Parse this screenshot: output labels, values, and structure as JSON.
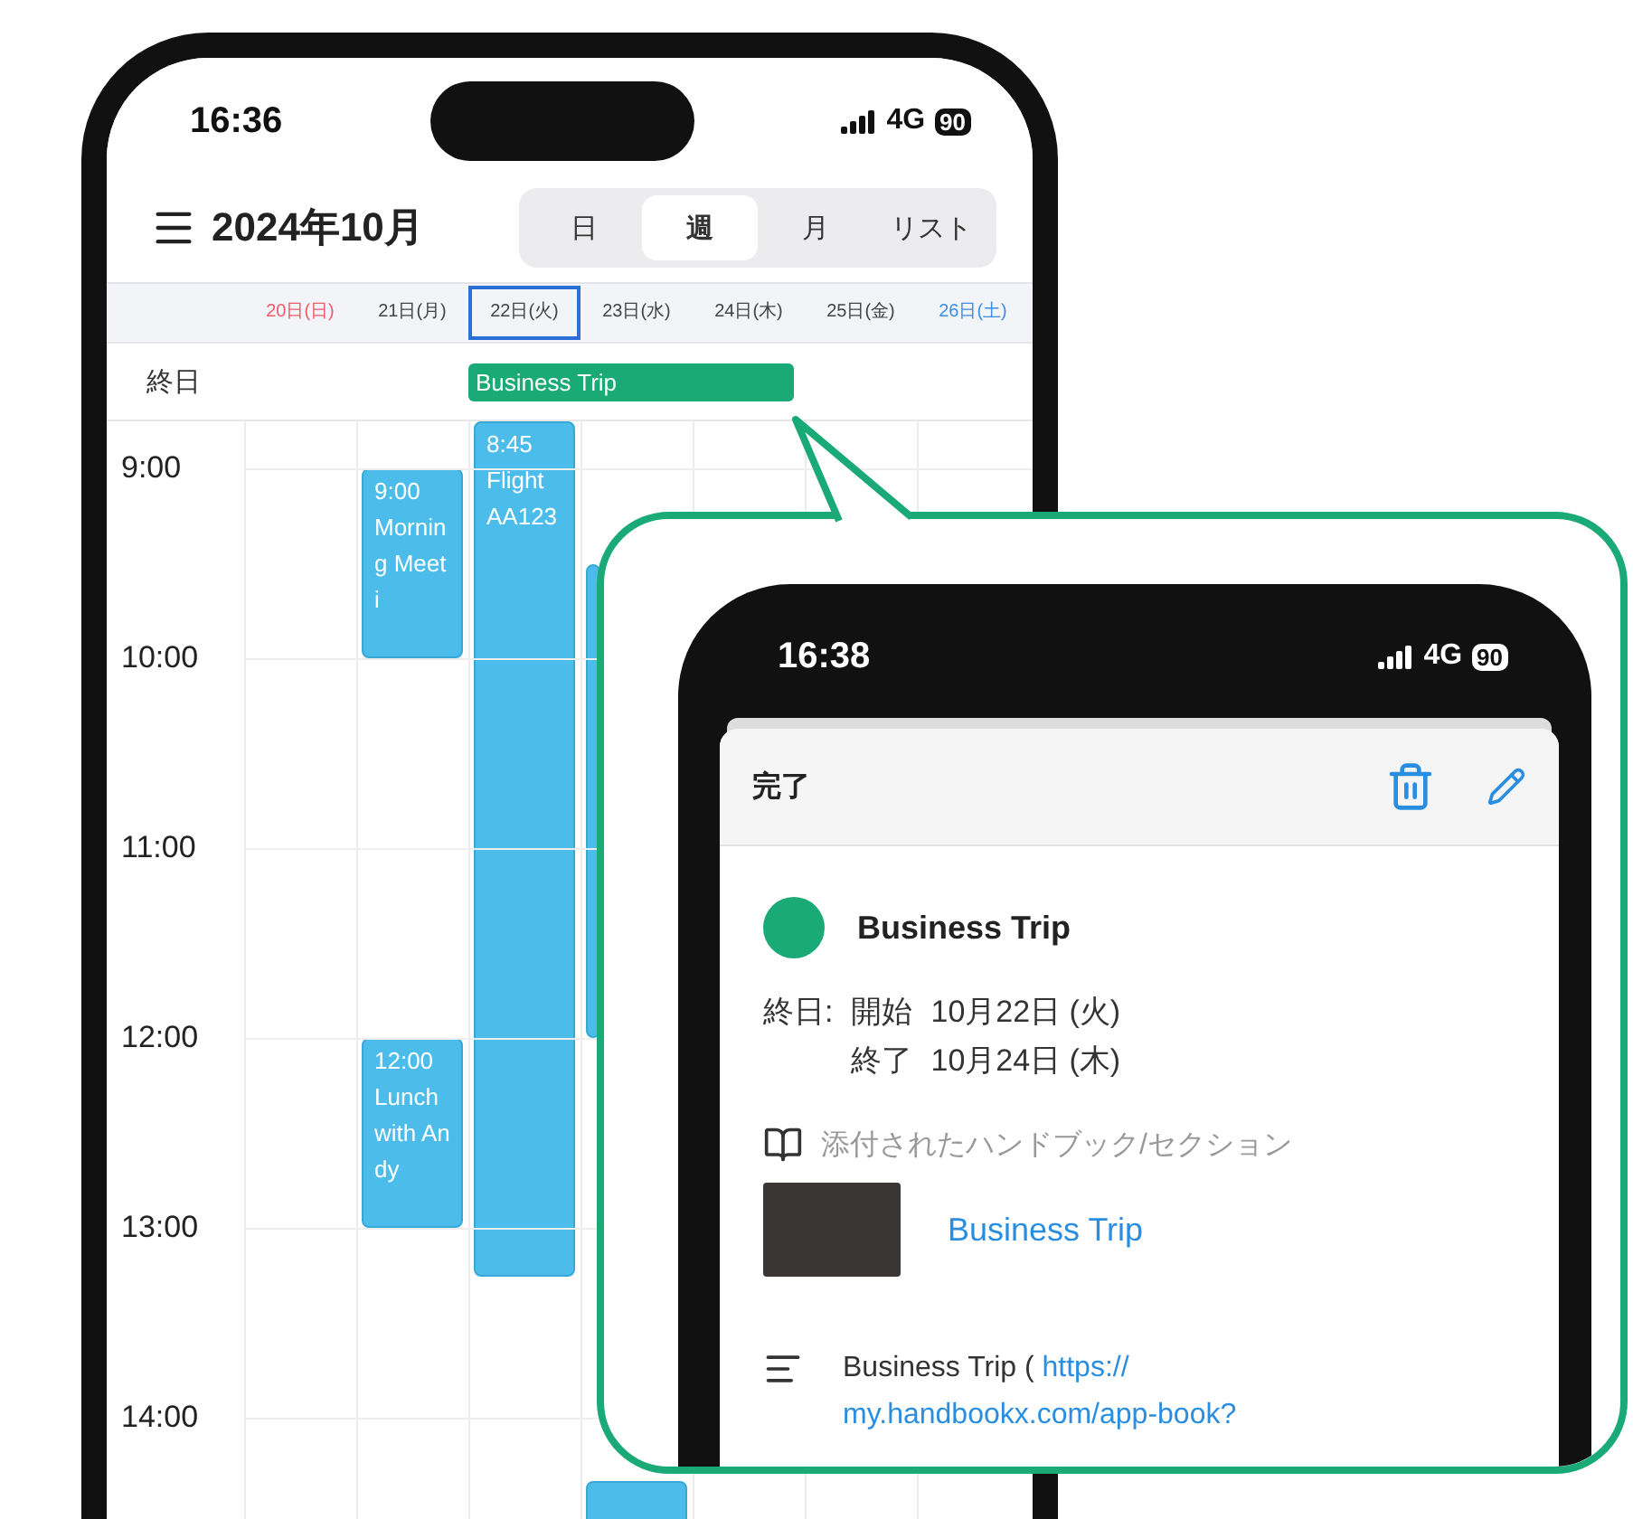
{
  "calendar_phone": {
    "status": {
      "time": "16:36",
      "network": "4G",
      "battery": "90"
    },
    "title": "2024年10月",
    "view_tabs": [
      {
        "label": "日",
        "selected": false
      },
      {
        "label": "週",
        "selected": true
      },
      {
        "label": "月",
        "selected": false
      },
      {
        "label": "リスト",
        "selected": false
      }
    ],
    "all_day_label": "終日",
    "days": [
      {
        "label": "20日(日)",
        "kind": "sunday",
        "selected": false
      },
      {
        "label": "21日(月)",
        "kind": "weekday",
        "selected": false,
        "events": [
          {
            "kind": "block",
            "time": "9:00",
            "title": "Morning Meeti"
          },
          {
            "kind": "block",
            "time": "12:00",
            "title": "Lunch with Andy"
          }
        ]
      },
      {
        "label": "22日(火)",
        "kind": "weekday",
        "selected": true,
        "all_day": {
          "title": "Business Trip",
          "color": "#1aaa78"
        },
        "events": [
          {
            "kind": "block",
            "time": "8:45",
            "title": "Flight AA123"
          }
        ]
      },
      {
        "label": "23日(水)",
        "kind": "weekday",
        "selected": false,
        "events": [
          {
            "kind": "strip"
          },
          {
            "kind": "block"
          }
        ]
      },
      {
        "label": "24日(木)",
        "kind": "weekday",
        "selected": false
      },
      {
        "label": "25日(金)",
        "kind": "weekday",
        "selected": false
      },
      {
        "label": "26日(土)",
        "kind": "saturday",
        "selected": false
      }
    ],
    "hours": [
      "9:00",
      "10:00",
      "11:00",
      "12:00",
      "13:00",
      "14:00"
    ]
  },
  "detail_phone": {
    "status": {
      "time": "16:38",
      "network": "4G",
      "battery": "90"
    },
    "done_label": "完了",
    "event": {
      "title": "Business Trip",
      "color": "#1aaa78"
    },
    "all_day_label": "終日:",
    "start_label": "開始",
    "start_date": "10月22日 (火)",
    "end_label": "終了",
    "end_date": "10月24日 (木)",
    "attachments_label": "添付されたハンドブック/セクション",
    "attachment": {
      "title": "Business Trip"
    },
    "note": {
      "text": "Business Trip (",
      "link_lines": [
        "https://",
        "my.handbookx.com/app-book?"
      ]
    }
  }
}
